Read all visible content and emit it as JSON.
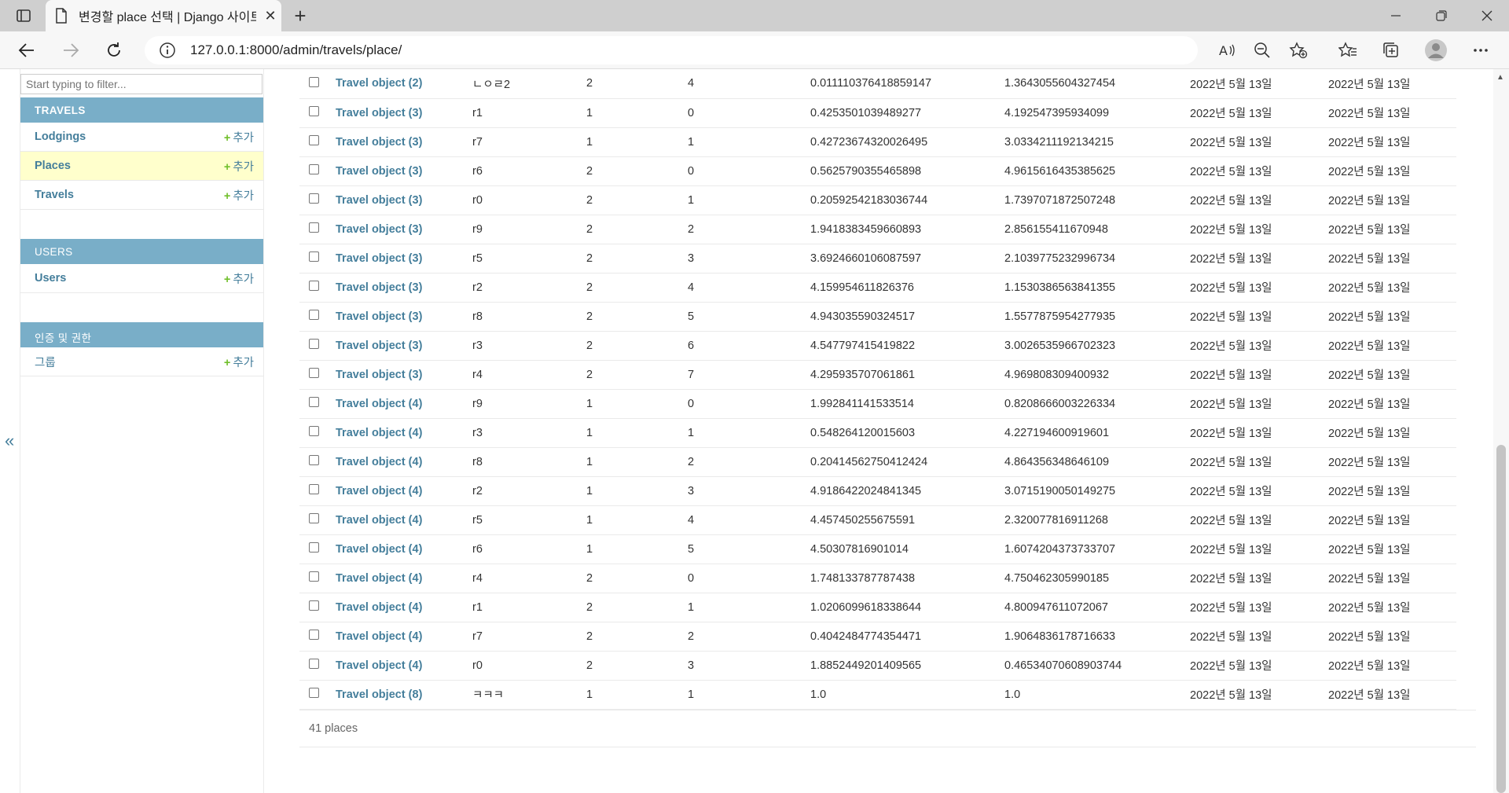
{
  "browser": {
    "tab_title": "변경할 place 선택 | Django 사이트 관리",
    "url": "127.0.0.1:8000/admin/travels/place/"
  },
  "sidebar": {
    "filter_placeholder": "Start typing to filter...",
    "add_label": "추가",
    "modules": [
      {
        "caption": "TRAVELS",
        "items": [
          {
            "label": "Lodgings"
          },
          {
            "label": "Places"
          },
          {
            "label": "Travels"
          }
        ]
      },
      {
        "caption": "USERS",
        "items": [
          {
            "label": "Users"
          }
        ]
      },
      {
        "caption": "인증 및 권한",
        "items": [
          {
            "label": "그룹"
          }
        ]
      }
    ],
    "collapse_label": "«"
  },
  "rows": [
    {
      "name": "Travel object (2)",
      "code": "ㄴㅇㄹ2",
      "a": "2",
      "b": "4",
      "lat": "0.011110376418859147",
      "lng": "1.3643055604327454",
      "d1": "2022년 5월 13일",
      "d2": "2022년 5월 13일"
    },
    {
      "name": "Travel object (3)",
      "code": "r1",
      "a": "1",
      "b": "0",
      "lat": "0.4253501039489277",
      "lng": "4.192547395934099",
      "d1": "2022년 5월 13일",
      "d2": "2022년 5월 13일"
    },
    {
      "name": "Travel object (3)",
      "code": "r7",
      "a": "1",
      "b": "1",
      "lat": "0.42723674320026495",
      "lng": "3.0334211192134215",
      "d1": "2022년 5월 13일",
      "d2": "2022년 5월 13일"
    },
    {
      "name": "Travel object (3)",
      "code": "r6",
      "a": "2",
      "b": "0",
      "lat": "0.5625790355465898",
      "lng": "4.9615616435385625",
      "d1": "2022년 5월 13일",
      "d2": "2022년 5월 13일"
    },
    {
      "name": "Travel object (3)",
      "code": "r0",
      "a": "2",
      "b": "1",
      "lat": "0.20592542183036744",
      "lng": "1.7397071872507248",
      "d1": "2022년 5월 13일",
      "d2": "2022년 5월 13일"
    },
    {
      "name": "Travel object (3)",
      "code": "r9",
      "a": "2",
      "b": "2",
      "lat": "1.9418383459660893",
      "lng": "2.856155411670948",
      "d1": "2022년 5월 13일",
      "d2": "2022년 5월 13일"
    },
    {
      "name": "Travel object (3)",
      "code": "r5",
      "a": "2",
      "b": "3",
      "lat": "3.6924660106087597",
      "lng": "2.1039775232996734",
      "d1": "2022년 5월 13일",
      "d2": "2022년 5월 13일"
    },
    {
      "name": "Travel object (3)",
      "code": "r2",
      "a": "2",
      "b": "4",
      "lat": "4.159954611826376",
      "lng": "1.1530386563841355",
      "d1": "2022년 5월 13일",
      "d2": "2022년 5월 13일"
    },
    {
      "name": "Travel object (3)",
      "code": "r8",
      "a": "2",
      "b": "5",
      "lat": "4.943035590324517",
      "lng": "1.5577875954277935",
      "d1": "2022년 5월 13일",
      "d2": "2022년 5월 13일"
    },
    {
      "name": "Travel object (3)",
      "code": "r3",
      "a": "2",
      "b": "6",
      "lat": "4.547797415419822",
      "lng": "3.0026535966702323",
      "d1": "2022년 5월 13일",
      "d2": "2022년 5월 13일"
    },
    {
      "name": "Travel object (3)",
      "code": "r4",
      "a": "2",
      "b": "7",
      "lat": "4.295935707061861",
      "lng": "4.969808309400932",
      "d1": "2022년 5월 13일",
      "d2": "2022년 5월 13일"
    },
    {
      "name": "Travel object (4)",
      "code": "r9",
      "a": "1",
      "b": "0",
      "lat": "1.992841141533514",
      "lng": "0.8208666003226334",
      "d1": "2022년 5월 13일",
      "d2": "2022년 5월 13일"
    },
    {
      "name": "Travel object (4)",
      "code": "r3",
      "a": "1",
      "b": "1",
      "lat": "0.548264120015603",
      "lng": "4.227194600919601",
      "d1": "2022년 5월 13일",
      "d2": "2022년 5월 13일"
    },
    {
      "name": "Travel object (4)",
      "code": "r8",
      "a": "1",
      "b": "2",
      "lat": "0.20414562750412424",
      "lng": "4.864356348646109",
      "d1": "2022년 5월 13일",
      "d2": "2022년 5월 13일"
    },
    {
      "name": "Travel object (4)",
      "code": "r2",
      "a": "1",
      "b": "3",
      "lat": "4.9186422024841345",
      "lng": "3.0715190050149275",
      "d1": "2022년 5월 13일",
      "d2": "2022년 5월 13일"
    },
    {
      "name": "Travel object (4)",
      "code": "r5",
      "a": "1",
      "b": "4",
      "lat": "4.457450255675591",
      "lng": "2.320077816911268",
      "d1": "2022년 5월 13일",
      "d2": "2022년 5월 13일"
    },
    {
      "name": "Travel object (4)",
      "code": "r6",
      "a": "1",
      "b": "5",
      "lat": "4.50307816901014",
      "lng": "1.6074204373733707",
      "d1": "2022년 5월 13일",
      "d2": "2022년 5월 13일"
    },
    {
      "name": "Travel object (4)",
      "code": "r4",
      "a": "2",
      "b": "0",
      "lat": "1.748133787787438",
      "lng": "4.750462305990185",
      "d1": "2022년 5월 13일",
      "d2": "2022년 5월 13일"
    },
    {
      "name": "Travel object (4)",
      "code": "r1",
      "a": "2",
      "b": "1",
      "lat": "1.0206099618338644",
      "lng": "4.800947611072067",
      "d1": "2022년 5월 13일",
      "d2": "2022년 5월 13일"
    },
    {
      "name": "Travel object (4)",
      "code": "r7",
      "a": "2",
      "b": "2",
      "lat": "0.4042484774354471",
      "lng": "1.9064836178716633",
      "d1": "2022년 5월 13일",
      "d2": "2022년 5월 13일"
    },
    {
      "name": "Travel object (4)",
      "code": "r0",
      "a": "2",
      "b": "3",
      "lat": "1.8852449201409565",
      "lng": "0.46534070608903744",
      "d1": "2022년 5월 13일",
      "d2": "2022년 5월 13일"
    },
    {
      "name": "Travel object (8)",
      "code": "ㅋㅋㅋ",
      "a": "1",
      "b": "1",
      "lat": "1.0",
      "lng": "1.0",
      "d1": "2022년 5월 13일",
      "d2": "2022년 5월 13일"
    }
  ],
  "paginator": {
    "count_text": "41 places"
  },
  "colors": {
    "accent": "#79aec8",
    "link": "#447e9b",
    "add_plus": "#70bf2b",
    "current_row": "#ffffcc"
  }
}
